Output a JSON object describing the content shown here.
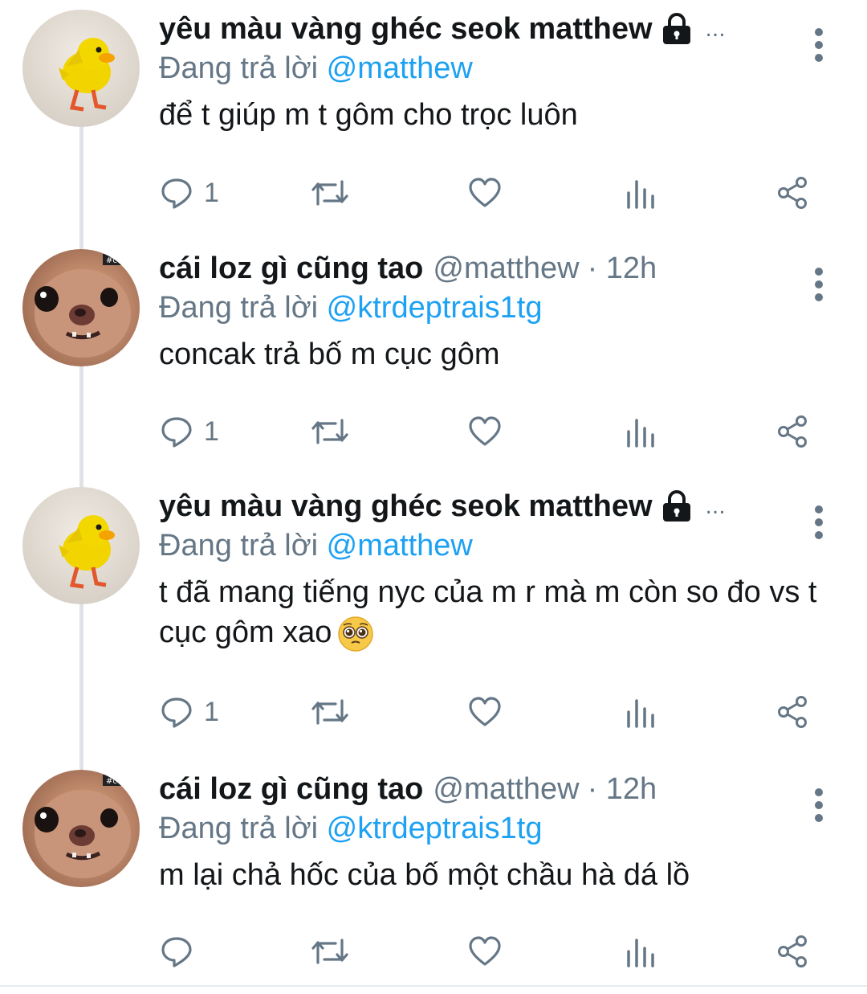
{
  "tweets": [
    {
      "display_name": "yêu màu vàng ghéc seok matthew",
      "locked": true,
      "ellipsis": "...",
      "handle": "",
      "time": "",
      "reply_prefix": "Đang trả lời",
      "reply_to": "@matthew",
      "body": "để t giúp m t gôm cho trọc luôn",
      "reply_count": "1",
      "avatar": "yellow-duck",
      "emoji": ""
    },
    {
      "display_name": "cái loz gì cũng tao",
      "locked": false,
      "ellipsis": "",
      "handle": "@matthew",
      "time": "· 12h",
      "reply_prefix": "Đang trả lời",
      "reply_to": "@ktrdeptrais1tg",
      "body": "concak trả bố m cục gôm",
      "reply_count": "1",
      "avatar": "chihuahua",
      "emoji": ""
    },
    {
      "display_name": "yêu màu vàng ghéc seok matthew",
      "locked": true,
      "ellipsis": "...",
      "handle": "",
      "time": "",
      "reply_prefix": "Đang trả lời",
      "reply_to": "@matthew",
      "body": "t đã mang tiếng nyc của m r mà m còn so đo vs t cục gôm xao",
      "reply_count": "1",
      "avatar": "yellow-duck",
      "emoji": "pleading-face"
    },
    {
      "display_name": "cái loz gì cũng tao",
      "locked": false,
      "ellipsis": "",
      "handle": "@matthew",
      "time": "· 12h",
      "reply_prefix": "Đang trả lời",
      "reply_to": "@ktrdeptrais1tg",
      "body": "m lại chả hốc của bố một chầu hà dá lồ",
      "reply_count": "",
      "avatar": "chihuahua",
      "emoji": ""
    }
  ],
  "colors": {
    "link": "#1da1f2",
    "secondary_text": "#657786",
    "primary_text": "#14171a",
    "thread_line": "#dfe3e7"
  },
  "icons": {
    "reply": "speech-bubble-icon",
    "retweet": "retweet-icon",
    "like": "heart-icon",
    "stats": "bar-chart-icon",
    "share": "share-icon",
    "more": "vertical-dots-icon",
    "lock": "lock-icon"
  }
}
